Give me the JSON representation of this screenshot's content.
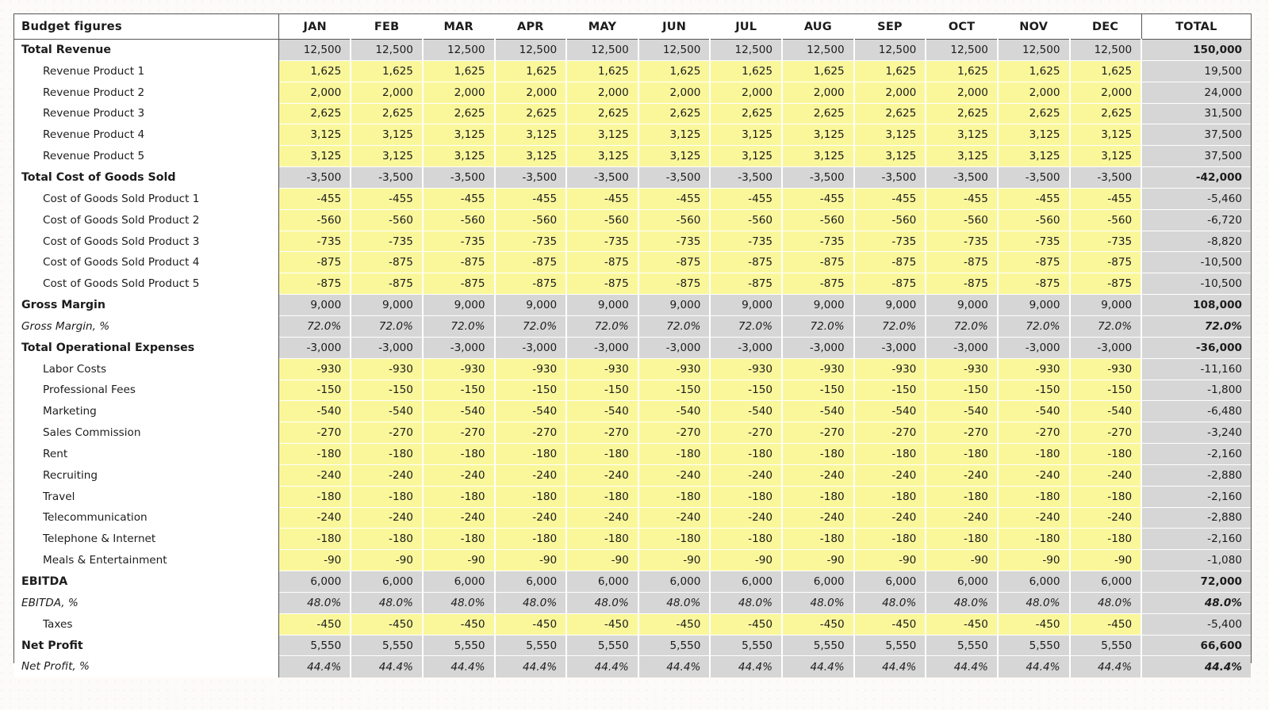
{
  "header": {
    "label_header": "Budget figures",
    "months": [
      "JAN",
      "FEB",
      "MAR",
      "APR",
      "MAY",
      "JUN",
      "JUL",
      "AUG",
      "SEP",
      "OCT",
      "NOV",
      "DEC"
    ],
    "total_header": "TOTAL"
  },
  "colors": {
    "subtotal_gray": "#d6d6d6",
    "input_yellow": "#faf79b",
    "grid_border": "#555555",
    "page_background": "#fdfbf9",
    "text": "#1c1c1c"
  },
  "chart_data": {
    "type": "table",
    "title": "Budget figures",
    "columns": [
      "Budget figures",
      "JAN",
      "FEB",
      "MAR",
      "APR",
      "MAY",
      "JUN",
      "JUL",
      "AUG",
      "SEP",
      "OCT",
      "NOV",
      "DEC",
      "TOTAL"
    ],
    "rows": [
      {
        "label": "Total Revenue",
        "style": "head",
        "values": [
          "12,500",
          "12,500",
          "12,500",
          "12,500",
          "12,500",
          "12,500",
          "12,500",
          "12,500",
          "12,500",
          "12,500",
          "12,500",
          "12,500"
        ],
        "total": "150,000"
      },
      {
        "label": "Revenue Product 1",
        "style": "item",
        "values": [
          "1,625",
          "1,625",
          "1,625",
          "1,625",
          "1,625",
          "1,625",
          "1,625",
          "1,625",
          "1,625",
          "1,625",
          "1,625",
          "1,625"
        ],
        "total": "19,500"
      },
      {
        "label": "Revenue Product 2",
        "style": "item",
        "values": [
          "2,000",
          "2,000",
          "2,000",
          "2,000",
          "2,000",
          "2,000",
          "2,000",
          "2,000",
          "2,000",
          "2,000",
          "2,000",
          "2,000"
        ],
        "total": "24,000"
      },
      {
        "label": "Revenue Product 3",
        "style": "item",
        "values": [
          "2,625",
          "2,625",
          "2,625",
          "2,625",
          "2,625",
          "2,625",
          "2,625",
          "2,625",
          "2,625",
          "2,625",
          "2,625",
          "2,625"
        ],
        "total": "31,500"
      },
      {
        "label": "Revenue Product 4",
        "style": "item",
        "values": [
          "3,125",
          "3,125",
          "3,125",
          "3,125",
          "3,125",
          "3,125",
          "3,125",
          "3,125",
          "3,125",
          "3,125",
          "3,125",
          "3,125"
        ],
        "total": "37,500"
      },
      {
        "label": "Revenue Product 5",
        "style": "item",
        "values": [
          "3,125",
          "3,125",
          "3,125",
          "3,125",
          "3,125",
          "3,125",
          "3,125",
          "3,125",
          "3,125",
          "3,125",
          "3,125",
          "3,125"
        ],
        "total": "37,500"
      },
      {
        "label": "Total Cost of Goods Sold",
        "style": "head",
        "values": [
          "-3,500",
          "-3,500",
          "-3,500",
          "-3,500",
          "-3,500",
          "-3,500",
          "-3,500",
          "-3,500",
          "-3,500",
          "-3,500",
          "-3,500",
          "-3,500"
        ],
        "total": "-42,000"
      },
      {
        "label": "Cost of Goods Sold Product 1",
        "style": "item",
        "values": [
          "-455",
          "-455",
          "-455",
          "-455",
          "-455",
          "-455",
          "-455",
          "-455",
          "-455",
          "-455",
          "-455",
          "-455"
        ],
        "total": "-5,460"
      },
      {
        "label": "Cost of Goods Sold Product 2",
        "style": "item",
        "values": [
          "-560",
          "-560",
          "-560",
          "-560",
          "-560",
          "-560",
          "-560",
          "-560",
          "-560",
          "-560",
          "-560",
          "-560"
        ],
        "total": "-6,720"
      },
      {
        "label": "Cost of Goods Sold Product 3",
        "style": "item",
        "values": [
          "-735",
          "-735",
          "-735",
          "-735",
          "-735",
          "-735",
          "-735",
          "-735",
          "-735",
          "-735",
          "-735",
          "-735"
        ],
        "total": "-8,820"
      },
      {
        "label": "Cost of Goods Sold Product 4",
        "style": "item",
        "values": [
          "-875",
          "-875",
          "-875",
          "-875",
          "-875",
          "-875",
          "-875",
          "-875",
          "-875",
          "-875",
          "-875",
          "-875"
        ],
        "total": "-10,500"
      },
      {
        "label": "Cost of Goods Sold Product 5",
        "style": "item",
        "values": [
          "-875",
          "-875",
          "-875",
          "-875",
          "-875",
          "-875",
          "-875",
          "-875",
          "-875",
          "-875",
          "-875",
          "-875"
        ],
        "total": "-10,500"
      },
      {
        "label": "Gross Margin",
        "style": "head",
        "values": [
          "9,000",
          "9,000",
          "9,000",
          "9,000",
          "9,000",
          "9,000",
          "9,000",
          "9,000",
          "9,000",
          "9,000",
          "9,000",
          "9,000"
        ],
        "total": "108,000"
      },
      {
        "label": "Gross Margin, %",
        "style": "pct",
        "values": [
          "72.0%",
          "72.0%",
          "72.0%",
          "72.0%",
          "72.0%",
          "72.0%",
          "72.0%",
          "72.0%",
          "72.0%",
          "72.0%",
          "72.0%",
          "72.0%"
        ],
        "total": "72.0%"
      },
      {
        "label": "Total Operational Expenses",
        "style": "head",
        "values": [
          "-3,000",
          "-3,000",
          "-3,000",
          "-3,000",
          "-3,000",
          "-3,000",
          "-3,000",
          "-3,000",
          "-3,000",
          "-3,000",
          "-3,000",
          "-3,000"
        ],
        "total": "-36,000"
      },
      {
        "label": "Labor Costs",
        "style": "item",
        "values": [
          "-930",
          "-930",
          "-930",
          "-930",
          "-930",
          "-930",
          "-930",
          "-930",
          "-930",
          "-930",
          "-930",
          "-930"
        ],
        "total": "-11,160"
      },
      {
        "label": "Professional Fees",
        "style": "item",
        "values": [
          "-150",
          "-150",
          "-150",
          "-150",
          "-150",
          "-150",
          "-150",
          "-150",
          "-150",
          "-150",
          "-150",
          "-150"
        ],
        "total": "-1,800"
      },
      {
        "label": "Marketing",
        "style": "item",
        "values": [
          "-540",
          "-540",
          "-540",
          "-540",
          "-540",
          "-540",
          "-540",
          "-540",
          "-540",
          "-540",
          "-540",
          "-540"
        ],
        "total": "-6,480"
      },
      {
        "label": "Sales Commission",
        "style": "item",
        "values": [
          "-270",
          "-270",
          "-270",
          "-270",
          "-270",
          "-270",
          "-270",
          "-270",
          "-270",
          "-270",
          "-270",
          "-270"
        ],
        "total": "-3,240"
      },
      {
        "label": "Rent",
        "style": "item",
        "values": [
          "-180",
          "-180",
          "-180",
          "-180",
          "-180",
          "-180",
          "-180",
          "-180",
          "-180",
          "-180",
          "-180",
          "-180"
        ],
        "total": "-2,160"
      },
      {
        "label": "Recruiting",
        "style": "item",
        "values": [
          "-240",
          "-240",
          "-240",
          "-240",
          "-240",
          "-240",
          "-240",
          "-240",
          "-240",
          "-240",
          "-240",
          "-240"
        ],
        "total": "-2,880"
      },
      {
        "label": "Travel",
        "style": "item",
        "values": [
          "-180",
          "-180",
          "-180",
          "-180",
          "-180",
          "-180",
          "-180",
          "-180",
          "-180",
          "-180",
          "-180",
          "-180"
        ],
        "total": "-2,160"
      },
      {
        "label": "Telecommunication",
        "style": "item",
        "values": [
          "-240",
          "-240",
          "-240",
          "-240",
          "-240",
          "-240",
          "-240",
          "-240",
          "-240",
          "-240",
          "-240",
          "-240"
        ],
        "total": "-2,880"
      },
      {
        "label": "Telephone & Internet",
        "style": "item",
        "values": [
          "-180",
          "-180",
          "-180",
          "-180",
          "-180",
          "-180",
          "-180",
          "-180",
          "-180",
          "-180",
          "-180",
          "-180"
        ],
        "total": "-2,160"
      },
      {
        "label": "Meals & Entertainment",
        "style": "item",
        "values": [
          "-90",
          "-90",
          "-90",
          "-90",
          "-90",
          "-90",
          "-90",
          "-90",
          "-90",
          "-90",
          "-90",
          "-90"
        ],
        "total": "-1,080"
      },
      {
        "label": "EBITDA",
        "style": "head",
        "values": [
          "6,000",
          "6,000",
          "6,000",
          "6,000",
          "6,000",
          "6,000",
          "6,000",
          "6,000",
          "6,000",
          "6,000",
          "6,000",
          "6,000"
        ],
        "total": "72,000"
      },
      {
        "label": "EBITDA, %",
        "style": "pct",
        "values": [
          "48.0%",
          "48.0%",
          "48.0%",
          "48.0%",
          "48.0%",
          "48.0%",
          "48.0%",
          "48.0%",
          "48.0%",
          "48.0%",
          "48.0%",
          "48.0%"
        ],
        "total": "48.0%"
      },
      {
        "label": "Taxes",
        "style": "item",
        "values": [
          "-450",
          "-450",
          "-450",
          "-450",
          "-450",
          "-450",
          "-450",
          "-450",
          "-450",
          "-450",
          "-450",
          "-450"
        ],
        "total": "-5,400"
      },
      {
        "label": "Net Profit",
        "style": "head",
        "values": [
          "5,550",
          "5,550",
          "5,550",
          "5,550",
          "5,550",
          "5,550",
          "5,550",
          "5,550",
          "5,550",
          "5,550",
          "5,550",
          "5,550"
        ],
        "total": "66,600"
      },
      {
        "label": "Net Profit, %",
        "style": "pct",
        "values": [
          "44.4%",
          "44.4%",
          "44.4%",
          "44.4%",
          "44.4%",
          "44.4%",
          "44.4%",
          "44.4%",
          "44.4%",
          "44.4%",
          "44.4%",
          "44.4%"
        ],
        "total": "44.4%"
      }
    ]
  }
}
